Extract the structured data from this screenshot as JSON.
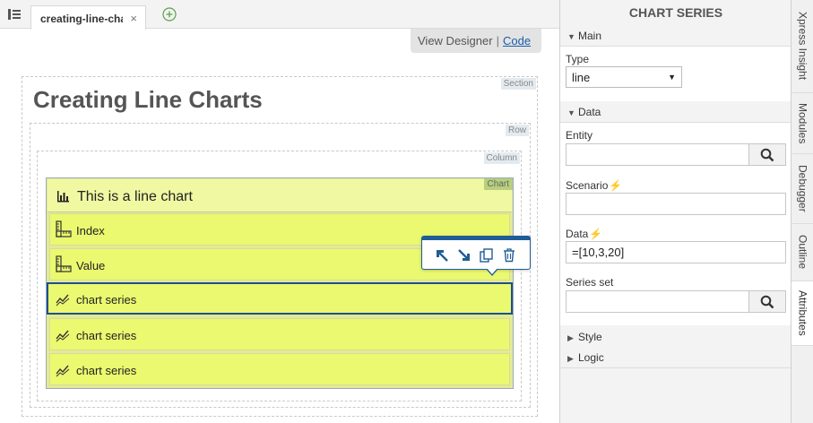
{
  "tabbar": {
    "file_tab": "creating-line-cha",
    "close": "×"
  },
  "view_toggle": {
    "designer": "View Designer",
    "separator": "|",
    "code": "Code"
  },
  "canvas": {
    "section_tag": "Section",
    "section_title": "Creating Line Charts",
    "row_tag": "Row",
    "column_tag": "Column",
    "chart_tag": "Chart",
    "chart_title": "This is a line chart",
    "items": [
      {
        "label": "Index",
        "icon": "ruler-icon"
      },
      {
        "label": "Value",
        "icon": "ruler-icon"
      },
      {
        "label": "chart series",
        "icon": "line-series-icon"
      },
      {
        "label": "chart series",
        "icon": "line-series-icon"
      },
      {
        "label": "chart series",
        "icon": "line-series-icon"
      }
    ]
  },
  "panel": {
    "title": "CHART SERIES",
    "main_group": "Main",
    "type_label": "Type",
    "type_value": "line",
    "data_group": "Data",
    "entity_label": "Entity",
    "entity_value": "",
    "scenario_label": "Scenario",
    "scenario_value": "",
    "data_label": "Data",
    "data_value": "=[10,3,20]",
    "series_set_label": "Series set",
    "series_set_value": "",
    "style_group": "Style",
    "logic_group": "Logic"
  },
  "side_tabs": [
    "Xpress Insight",
    "Modules",
    "Debugger",
    "Outline",
    "Attributes"
  ],
  "colors": {
    "accent": "#1f5d96",
    "item_bg": "#eaf96f",
    "chart_header_bg": "#f0f8a2",
    "bolt": "#f5a000"
  }
}
